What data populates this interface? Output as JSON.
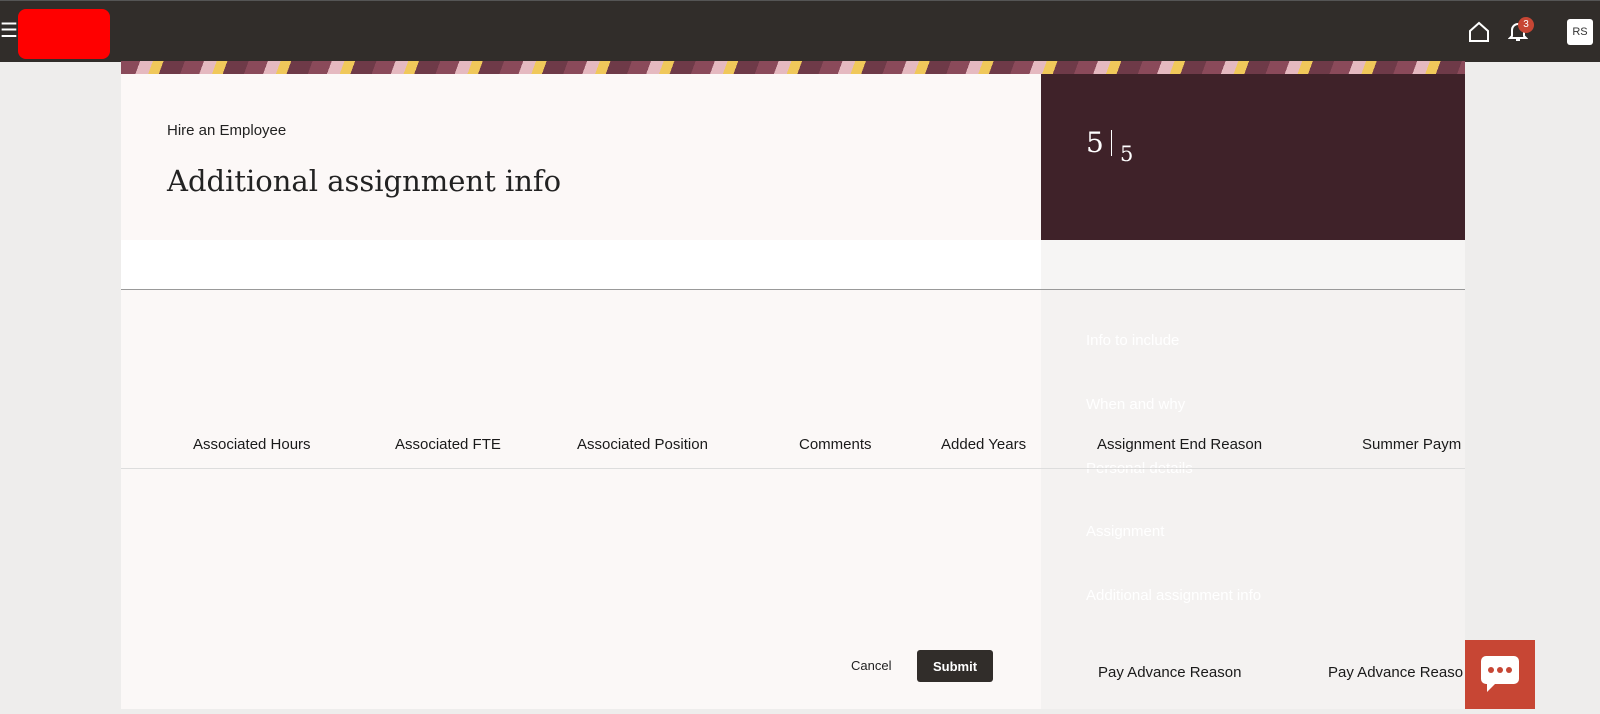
{
  "topbar": {
    "menu_icon": "hamburger-icon",
    "home_icon": "home-icon",
    "bell_icon": "bell-icon",
    "notification_count": "3",
    "avatar": "RS"
  },
  "header": {
    "subtitle": "Hire an Employee",
    "title": "Additional assignment info"
  },
  "steps": {
    "current": "5",
    "total": "5",
    "items": [
      "Info to include",
      "When and why",
      "Personal details",
      "Assignment",
      "Additional assignment info"
    ]
  },
  "columns": [
    "Associated Hours",
    "Associated FTE",
    "Associated Position",
    "Comments",
    "Added Years",
    "Assignment End Reason",
    "Summer Paym"
  ],
  "actions": {
    "cancel": "Cancel",
    "submit": "Submit"
  },
  "bottom_columns": [
    "Pay Advance Reason",
    "Pay Advance Reaso"
  ],
  "colors": {
    "topbar": "#312d2a",
    "step_panel": "#3f2229",
    "accent": "#c74634"
  }
}
